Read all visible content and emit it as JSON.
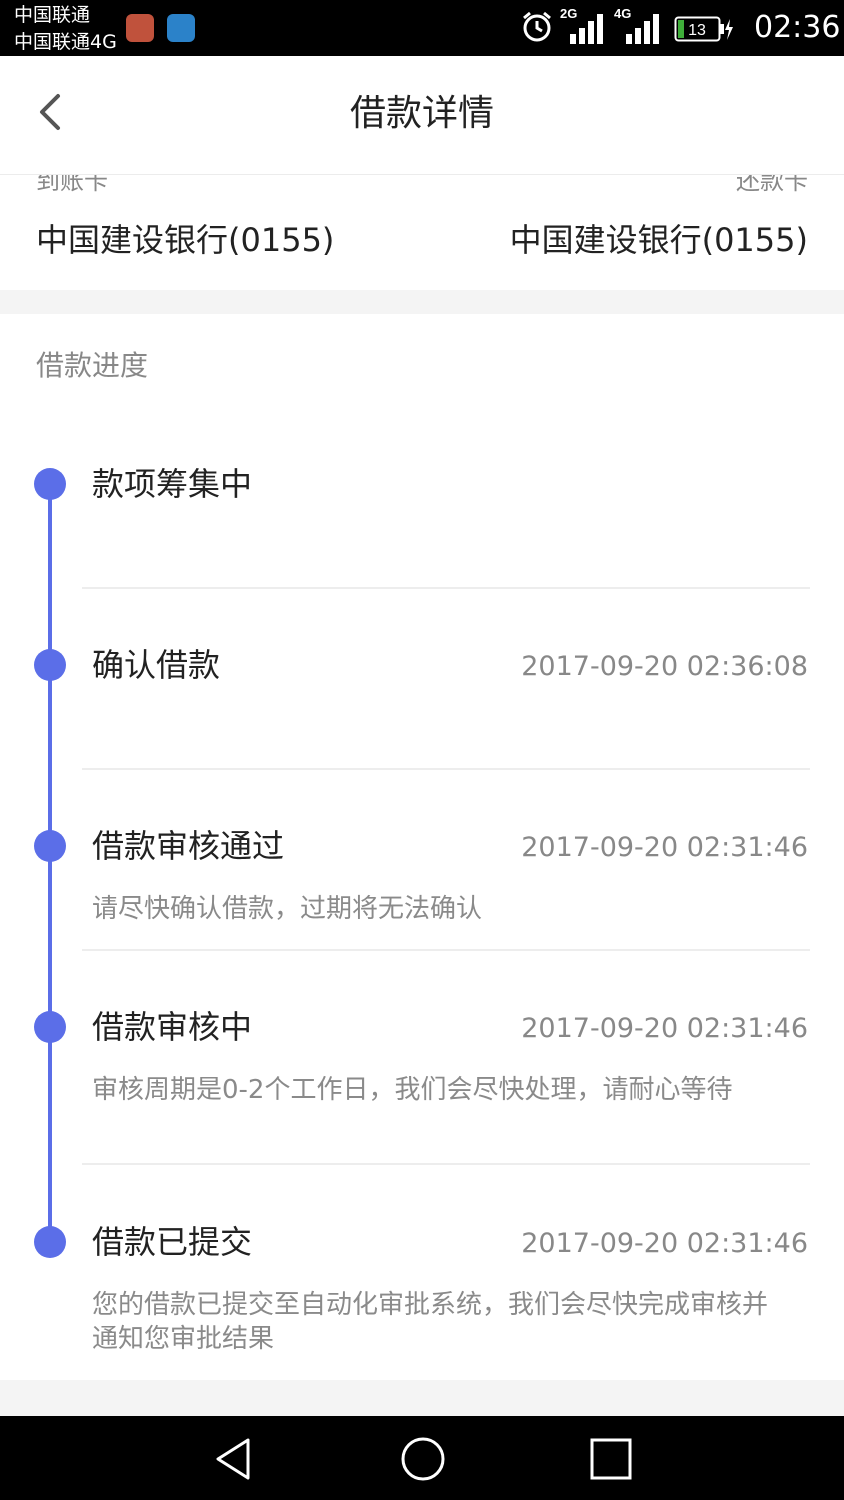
{
  "status_bar": {
    "carrier_1": "中国联通",
    "carrier_2": "中国联通4G",
    "signal_1_type": "2G",
    "signal_2_type": "4G",
    "battery_level": "13",
    "time": "02:36"
  },
  "header": {
    "title": "借款详情",
    "back_icon": "chevron-left-icon"
  },
  "accounts": {
    "left_label_partial": "到账卡",
    "right_label_partial": "还款卡",
    "left_bank": "中国建设银行(0155)",
    "right_bank": "中国建设银行(0155)"
  },
  "progress": {
    "section_title": "借款进度",
    "steps": [
      {
        "title": "款项筹集中",
        "time": "",
        "desc": ""
      },
      {
        "title": "确认借款",
        "time": "2017-09-20 02:36:08",
        "desc": ""
      },
      {
        "title": "借款审核通过",
        "time": "2017-09-20 02:31:46",
        "desc": "请尽快确认借款，过期将无法确认"
      },
      {
        "title": "借款审核中",
        "time": "2017-09-20 02:31:46",
        "desc": "审核周期是0-2个工作日，我们会尽快处理，请耐心等待"
      },
      {
        "title": "借款已提交",
        "time": "2017-09-20 02:31:46",
        "desc": "您的借款已提交至自动化审批系统，我们会尽快完成审核并通知您审批结果"
      }
    ]
  },
  "colors": {
    "accent": "#5b6ee8",
    "text_primary": "#222222",
    "text_secondary": "#888888"
  },
  "nav_bar": {
    "back_icon": "triangle-back-icon",
    "home_icon": "circle-home-icon",
    "recent_icon": "square-recent-icon"
  }
}
